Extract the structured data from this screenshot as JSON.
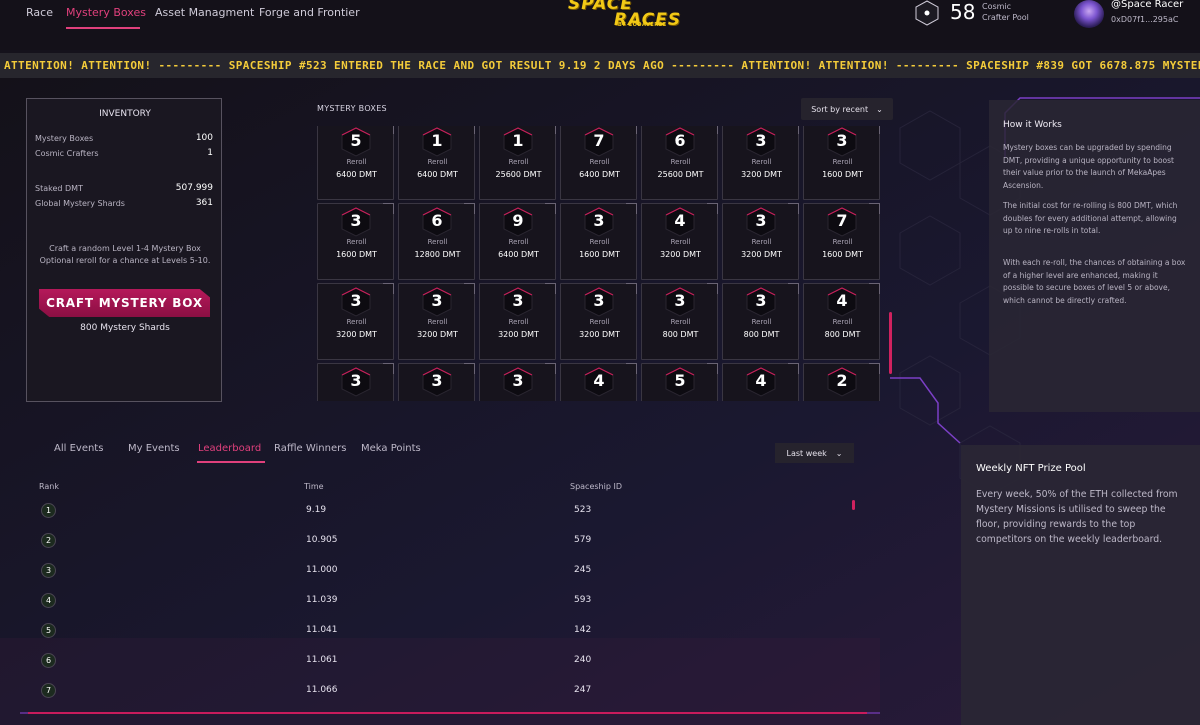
{
  "nav": {
    "links": [
      "Race",
      "Mystery Boxes",
      "Asset Managment",
      "Forge and Frontier"
    ],
    "active": "Mystery Boxes"
  },
  "logo": {
    "line1": "SPACE",
    "line2": "RACES",
    "byline": "BY CODAVERSE"
  },
  "pool": {
    "count": "58",
    "label_line1": "Cosmic",
    "label_line2": "Crafter Pool"
  },
  "user": {
    "name": "@Space Racer",
    "address": "0xD07f1...295aC"
  },
  "ticker": {
    "text": "ATTENTION! ATTENTION! --------- SPACESHIP #523 ENTERED THE RACE AND GOT RESULT 9.19 2 DAYS AGO --------- ATTENTION! ATTENTION! --------- SPACESHIP #839 GOT 6678.875 MYSTERY SHARDS FROM A MYS"
  },
  "inventory": {
    "title": "INVENTORY",
    "mystery_boxes_label": "Mystery Boxes",
    "mystery_boxes_value": "100",
    "cosmic_crafters_label": "Cosmic Crafters",
    "cosmic_crafters_value": "1",
    "staked_dmt_label": "Staked DMT",
    "staked_dmt_value": "507.999",
    "global_shards_label": "Global Mystery Shards",
    "global_shards_value": "361",
    "note_line1": "Craft a random Level 1-4 Mystery Box",
    "note_line2": "Optional reroll for a chance at Levels 5-10.",
    "craft_button": "CRAFT MYSTERY BOX",
    "craft_cost": "800 Mystery Shards"
  },
  "mystery": {
    "title": "MYSTERY BOXES",
    "sort_label": "Sort by recent",
    "reroll_label": "Reroll",
    "boxes": [
      {
        "level": "5",
        "cost": "6400 DMT"
      },
      {
        "level": "1",
        "cost": "6400 DMT"
      },
      {
        "level": "1",
        "cost": "25600 DMT"
      },
      {
        "level": "7",
        "cost": "6400 DMT"
      },
      {
        "level": "6",
        "cost": "25600 DMT"
      },
      {
        "level": "3",
        "cost": "3200 DMT"
      },
      {
        "level": "3",
        "cost": "1600 DMT"
      },
      {
        "level": "3",
        "cost": "1600 DMT"
      },
      {
        "level": "6",
        "cost": "12800 DMT"
      },
      {
        "level": "9",
        "cost": "6400 DMT"
      },
      {
        "level": "3",
        "cost": "1600 DMT"
      },
      {
        "level": "4",
        "cost": "3200 DMT"
      },
      {
        "level": "3",
        "cost": "3200 DMT"
      },
      {
        "level": "7",
        "cost": "1600 DMT"
      },
      {
        "level": "3",
        "cost": "3200 DMT"
      },
      {
        "level": "3",
        "cost": "3200 DMT"
      },
      {
        "level": "3",
        "cost": "3200 DMT"
      },
      {
        "level": "3",
        "cost": "3200 DMT"
      },
      {
        "level": "3",
        "cost": "800 DMT"
      },
      {
        "level": "3",
        "cost": "800 DMT"
      },
      {
        "level": "4",
        "cost": "800 DMT"
      },
      {
        "level": "3",
        "cost": ""
      },
      {
        "level": "3",
        "cost": ""
      },
      {
        "level": "3",
        "cost": ""
      },
      {
        "level": "4",
        "cost": ""
      },
      {
        "level": "5",
        "cost": ""
      },
      {
        "level": "4",
        "cost": ""
      },
      {
        "level": "2",
        "cost": ""
      }
    ]
  },
  "how": {
    "title": "How it Works",
    "p1": "Mystery boxes can be upgraded by spending DMT, providing a unique opportunity to boost their value prior to the launch of MekaApes Ascension.",
    "p2": "The initial cost for re-rolling is 800 DMT, which doubles for every additional attempt, allowing up to nine re-rolls in total.",
    "p3": "With each re-roll, the chances of obtaining a box of a higher level are enhanced, making it possible to secure boxes of level 5 or above, which cannot be directly crafted."
  },
  "leaderboard": {
    "tabs": [
      "All Events",
      "My Events",
      "Leaderboard",
      "Raffle Winners",
      "Meka Points"
    ],
    "active_tab": "Leaderboard",
    "range_label": "Last week",
    "col_rank": "Rank",
    "col_time": "Time",
    "col_ship": "Spaceship ID",
    "rows": [
      {
        "rank": "1",
        "time": "9.19",
        "ship": "523"
      },
      {
        "rank": "2",
        "time": "10.905",
        "ship": "579"
      },
      {
        "rank": "3",
        "time": "11.000",
        "ship": "245"
      },
      {
        "rank": "4",
        "time": "11.039",
        "ship": "593"
      },
      {
        "rank": "5",
        "time": "11.041",
        "ship": "142"
      },
      {
        "rank": "6",
        "time": "11.061",
        "ship": "240"
      },
      {
        "rank": "7",
        "time": "11.066",
        "ship": "247"
      }
    ]
  },
  "prize": {
    "title": "Weekly NFT Prize Pool",
    "text": "Every week, 50% of the ETH collected from Mystery Missions is utilised to sweep the floor, providing rewards to the top competitors on the weekly leaderboard."
  },
  "colors": {
    "accent": "#e0407c",
    "ticker_text": "#f4cc3a",
    "button": "#b5195a",
    "background": "#15121c"
  }
}
